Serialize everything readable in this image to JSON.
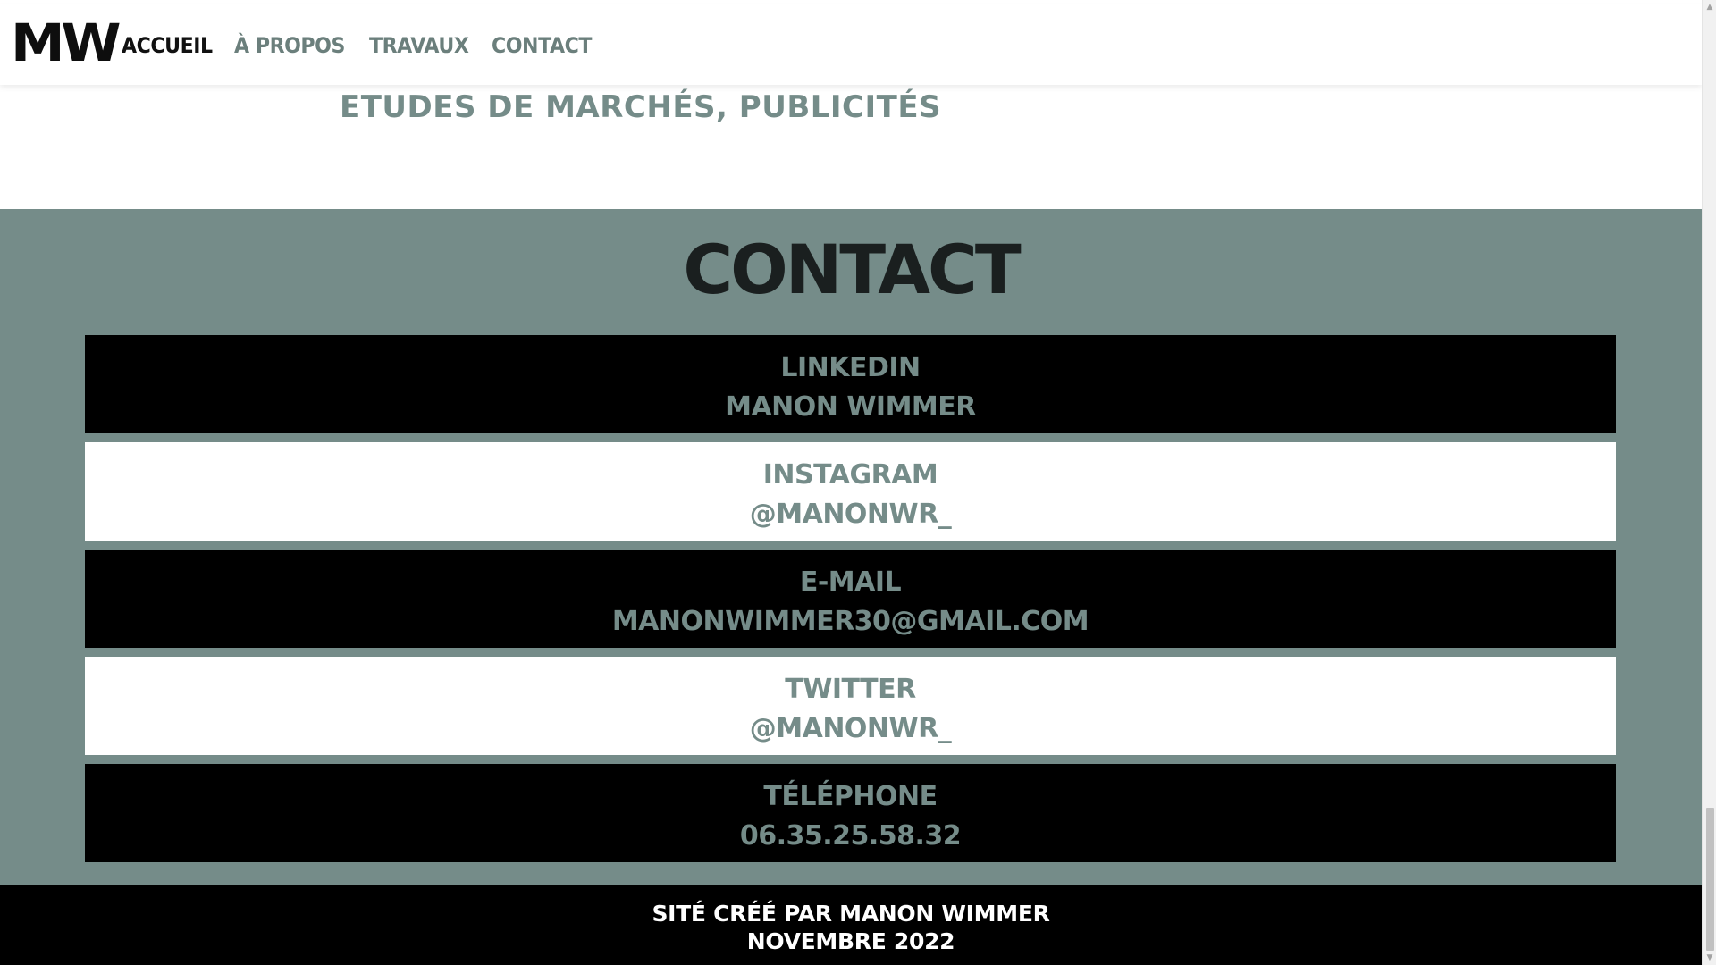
{
  "nav": {
    "logo": "MW",
    "links": [
      "ACCUEIL",
      "À PROPOS",
      "TRAVAUX",
      "CONTACT"
    ],
    "active": "ACCUEIL"
  },
  "projects": {
    "line": "ETUDES DE MARCHÉS, PUBLICITÉS"
  },
  "contact": {
    "title": "CONTACT",
    "cards": [
      {
        "label": "LINKEDIN",
        "value": "MANON WIMMER",
        "theme": "dark"
      },
      {
        "label": "INSTAGRAM",
        "value": "@MANONWR_",
        "theme": "light"
      },
      {
        "label": "E-MAIL",
        "value": "MANONWIMMER30@GMAIL.COM",
        "theme": "dark"
      },
      {
        "label": "TWITTER",
        "value": "@MANONWR_",
        "theme": "light"
      },
      {
        "label": "TÉLÉPHONE",
        "value": "06.35.25.58.32",
        "theme": "dark"
      }
    ]
  },
  "footer": {
    "line1": "SITÉ CRÉÉ PAR MANON WIMMER",
    "line2": "NOVEMBRE 2022"
  },
  "colors": {
    "accent": "#758c89",
    "dark": "#000000",
    "light": "#ffffff"
  },
  "icons": {
    "scroll_up": "scroll-up-arrow-icon",
    "scroll_down": "scroll-down-arrow-icon"
  }
}
